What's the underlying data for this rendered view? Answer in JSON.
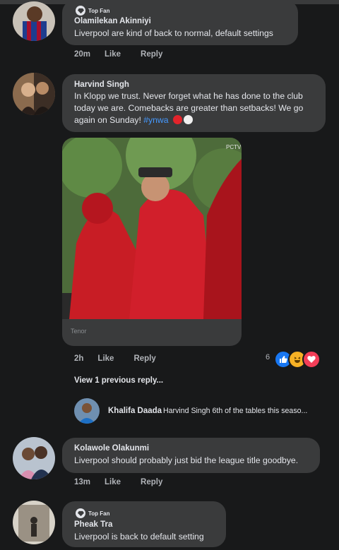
{
  "colors": {
    "background": "#18191a",
    "bubble": "#3a3b3c",
    "text_primary": "#e4e6eb",
    "text_secondary": "#b0b3b8",
    "link": "#4599ff",
    "like_blue": "#1877f2",
    "haha_yellow": "#f7b125",
    "love_red": "#f33e58"
  },
  "comments": [
    {
      "badge": "Top Fan",
      "author": "Olamilekan Akinniyi",
      "text": "Liverpool are kind of back to normal, default settings",
      "time": "20m",
      "like": "Like",
      "reply": "Reply",
      "avatar_icon": "user-avatar-jersey"
    },
    {
      "author": "Harvind Singh",
      "text": "In Klopp we trust. Never forget what he has done to the club today we are. Comebacks are greater than setbacks! We go again on Sunday! ",
      "hashtag": "#ynwa",
      "time": "2h",
      "like": "Like",
      "reply": "Reply",
      "gif_source": "Tenor",
      "reaction_count": "6",
      "reactions": [
        "like-icon",
        "haha-icon",
        "love-icon"
      ],
      "view_replies": "View 1 previous reply...",
      "reply_preview": {
        "author": "Khalifa Daada",
        "text": "Harvind Singh  6th of the tables this seaso..."
      }
    },
    {
      "author": "Kolawole Olakunmi",
      "text": "Liverpool should probably just bid the league title goodbye.",
      "time": "13m",
      "like": "Like",
      "reply": "Reply"
    },
    {
      "badge": "Top Fan",
      "author": "Pheak Tra",
      "text": "Liverpool is back to default setting"
    }
  ]
}
